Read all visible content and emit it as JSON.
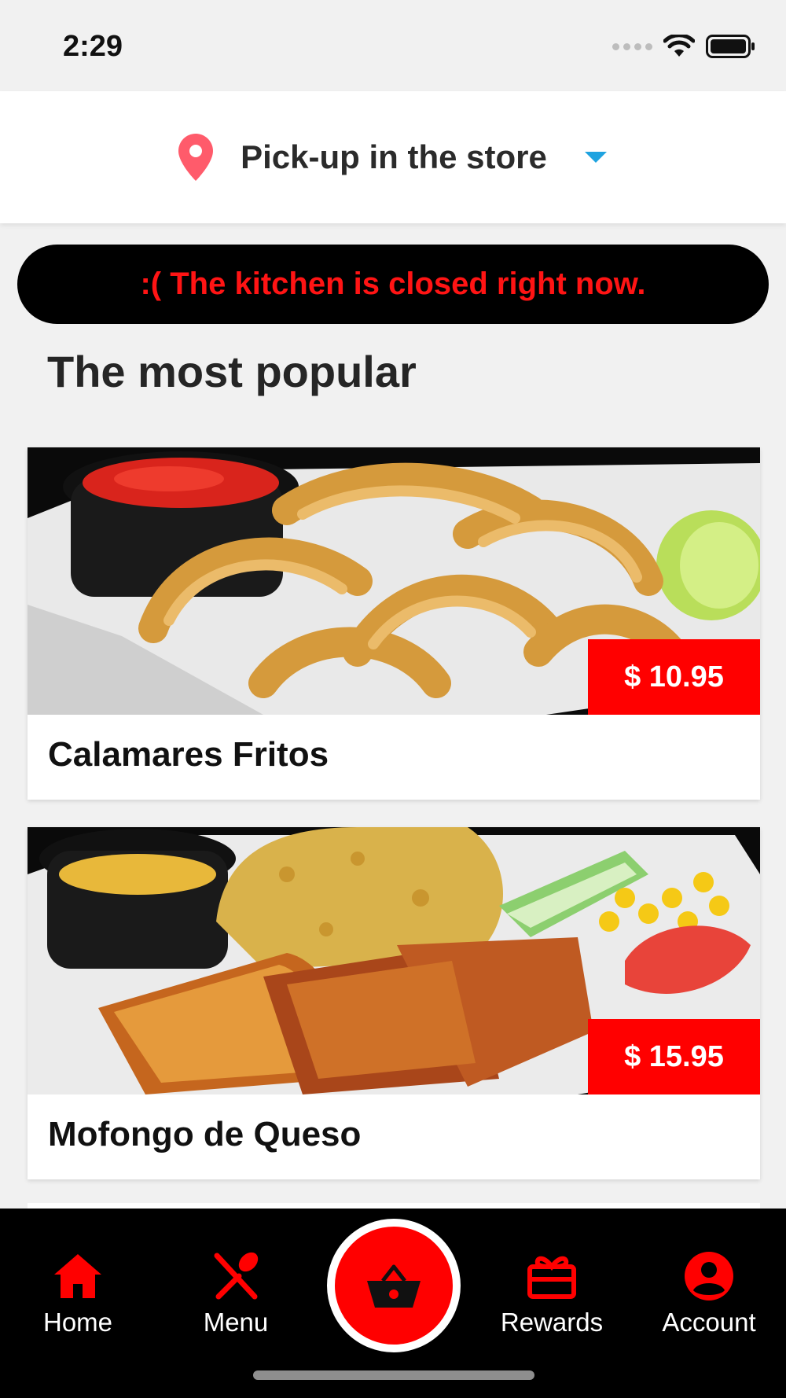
{
  "status_bar": {
    "time": "2:29"
  },
  "location": {
    "label": "Pick-up in the store"
  },
  "banner": {
    "text": ":( The kitchen is closed right now."
  },
  "section": {
    "title": "The most popular"
  },
  "products": [
    {
      "name": "Calamares Fritos",
      "price": "$ 10.95"
    },
    {
      "name": "Mofongo de Queso",
      "price": "$ 15.95"
    }
  ],
  "nav": {
    "home": "Home",
    "menu": "Menu",
    "rewards": "Rewards",
    "account": "Account"
  },
  "colors": {
    "accent": "#ff0000",
    "pin": "#ff5b6b",
    "caret": "#1fa3e0",
    "nav_background": "#000000"
  },
  "icons": [
    "location-pin-icon",
    "caret-down-icon",
    "home-icon",
    "fork-knife-icon",
    "basket-icon",
    "gift-icon",
    "account-icon",
    "wifi-icon",
    "battery-icon"
  ]
}
